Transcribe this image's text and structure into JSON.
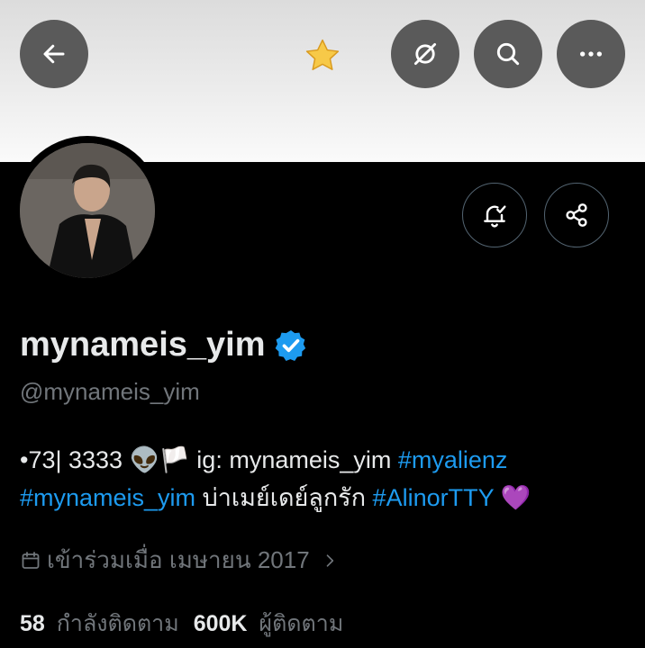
{
  "header": {
    "back_icon": "arrow-left-icon",
    "favorite_icon": "star-icon",
    "grok_icon": "grok-slash-icon",
    "search_icon": "search-icon",
    "more_icon": "more-horizontal-icon"
  },
  "profile": {
    "display_name": "mynameis_yim",
    "verified_color": "#1d9bf0",
    "handle": "@mynameis_yim",
    "bio": {
      "t1": "•73| 3333 👽🏳️ ig: mynameis_yim ",
      "h1": "#myalienz",
      "h2": "#mynameis_yim",
      "t2": " บ่าเมย์เดย์ลูกรัก ",
      "h3": "#AlinorTTY",
      "t3": " 💜"
    },
    "joined": "เข้าร่วมเมื่อ เมษายน 2017",
    "following_count": "58",
    "following_label": "กำลังติดตาม",
    "followers_count": "600K",
    "followers_label": "ผู้ติดตาม"
  },
  "colors": {
    "link": "#1d9bf0",
    "muted": "#71767b",
    "text": "#e7e9ea",
    "background": "#000000"
  }
}
